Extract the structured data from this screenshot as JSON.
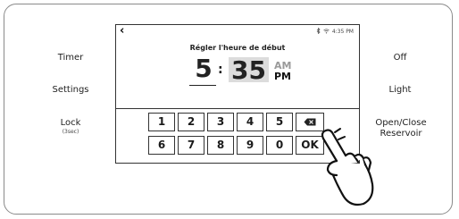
{
  "left_buttons": {
    "timer": "Timer",
    "settings": "Settings",
    "lock": "Lock",
    "lock_sub": "(3sec)"
  },
  "right_buttons": {
    "off": "Off",
    "light": "Light",
    "reservoir_line1": "Open/Close",
    "reservoir_line2": "Reservoir"
  },
  "screen": {
    "back_icon": "chevron-left-icon",
    "status_time": "4:35 PM",
    "status_icons": [
      "bluetooth-icon",
      "wifi-icon"
    ],
    "title": "Régler l'heure de début",
    "hour": "5",
    "colon": ":",
    "minute": "35",
    "am": "AM",
    "pm": "PM"
  },
  "keypad": {
    "row1": [
      "1",
      "2",
      "3",
      "4",
      "5"
    ],
    "row2": [
      "6",
      "7",
      "8",
      "9",
      "0"
    ],
    "backspace_icon": "backspace-icon",
    "ok": "OK"
  },
  "overlay": {
    "icon": "pointing-hand-icon"
  }
}
